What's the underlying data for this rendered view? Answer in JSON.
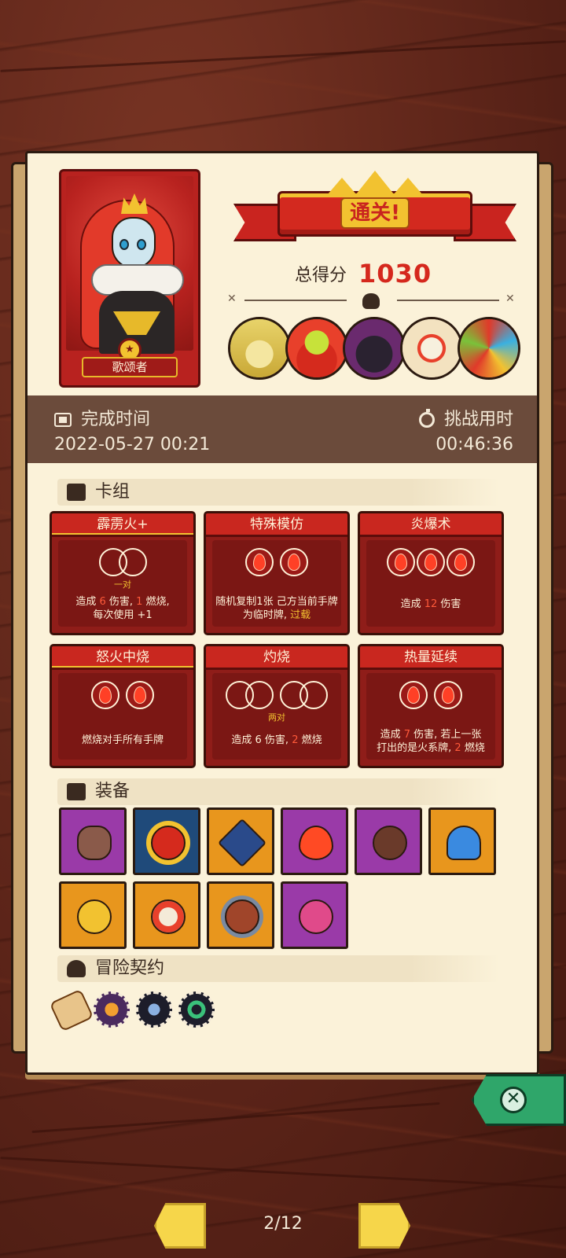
{
  "hero": {
    "name": "歌颂者"
  },
  "result": {
    "banner": "通关!",
    "score_label": "总得分",
    "score_value": "1030"
  },
  "bosses": [
    {
      "name": "boss-straw-hat",
      "bg": "#e8d36a"
    },
    {
      "name": "boss-red-demon",
      "bg": "#e8402b"
    },
    {
      "name": "boss-shadow-beast",
      "bg": "#6a2a6e"
    },
    {
      "name": "boss-tribal-mask",
      "bg": "#f3e2c0"
    },
    {
      "name": "boss-colorful-egg",
      "bg": "#e03a2a"
    }
  ],
  "times": {
    "finish_label": "完成时间",
    "finish_value": "2022-05-27 00:21",
    "challenge_label": "挑战用时",
    "challenge_value": "00:46:36"
  },
  "sections": {
    "deck": "卡组",
    "equipment": "装备",
    "contracts": "冒险契约"
  },
  "cards": [
    {
      "title": "霹雳火+",
      "pair_label": "一对",
      "desc_parts": [
        "造成 ",
        "6",
        " 伤害, ",
        "1",
        " 燃烧,",
        "每次使用 ",
        "+1"
      ]
    },
    {
      "title": "特殊模仿",
      "desc_a": "随机复制1张 己方当前手牌",
      "desc_b": "为临时牌, ",
      "desc_hl": "过载"
    },
    {
      "title": "炎爆术",
      "desc_a": "造成 ",
      "desc_hl": "12",
      "desc_b": " 伤害"
    },
    {
      "title": "怒火中烧",
      "desc_a": "燃烧对手所有手牌"
    },
    {
      "title": "灼烧",
      "pair_label": "两对",
      "desc_a": "造成 ",
      "desc_b": "6 伤害, ",
      "desc_hl": "2",
      "desc_c": " 燃烧"
    },
    {
      "title": "热量延续",
      "desc_a": "造成 ",
      "desc_hl": "7",
      "desc_b": " 伤害, 若上一张",
      "desc_c": "打出的是火系牌, ",
      "desc_hl2": "2",
      "desc_d": " 燃烧"
    }
  ],
  "equipment": [
    {
      "name": "rock-relic",
      "color": "purple"
    },
    {
      "name": "rune-ring",
      "color": "blue"
    },
    {
      "name": "hexagram-emblem",
      "color": "orange"
    },
    {
      "name": "flame-charm",
      "color": "purple"
    },
    {
      "name": "button-coin",
      "color": "purple"
    },
    {
      "name": "blue-mushroom",
      "color": "orange"
    },
    {
      "name": "coin-pouch",
      "color": "orange"
    },
    {
      "name": "donut-ring",
      "color": "orange"
    },
    {
      "name": "fire-bowl",
      "color": "orange"
    },
    {
      "name": "spotted-shell",
      "color": "purple"
    }
  ],
  "pagination": {
    "label": "2/12"
  }
}
